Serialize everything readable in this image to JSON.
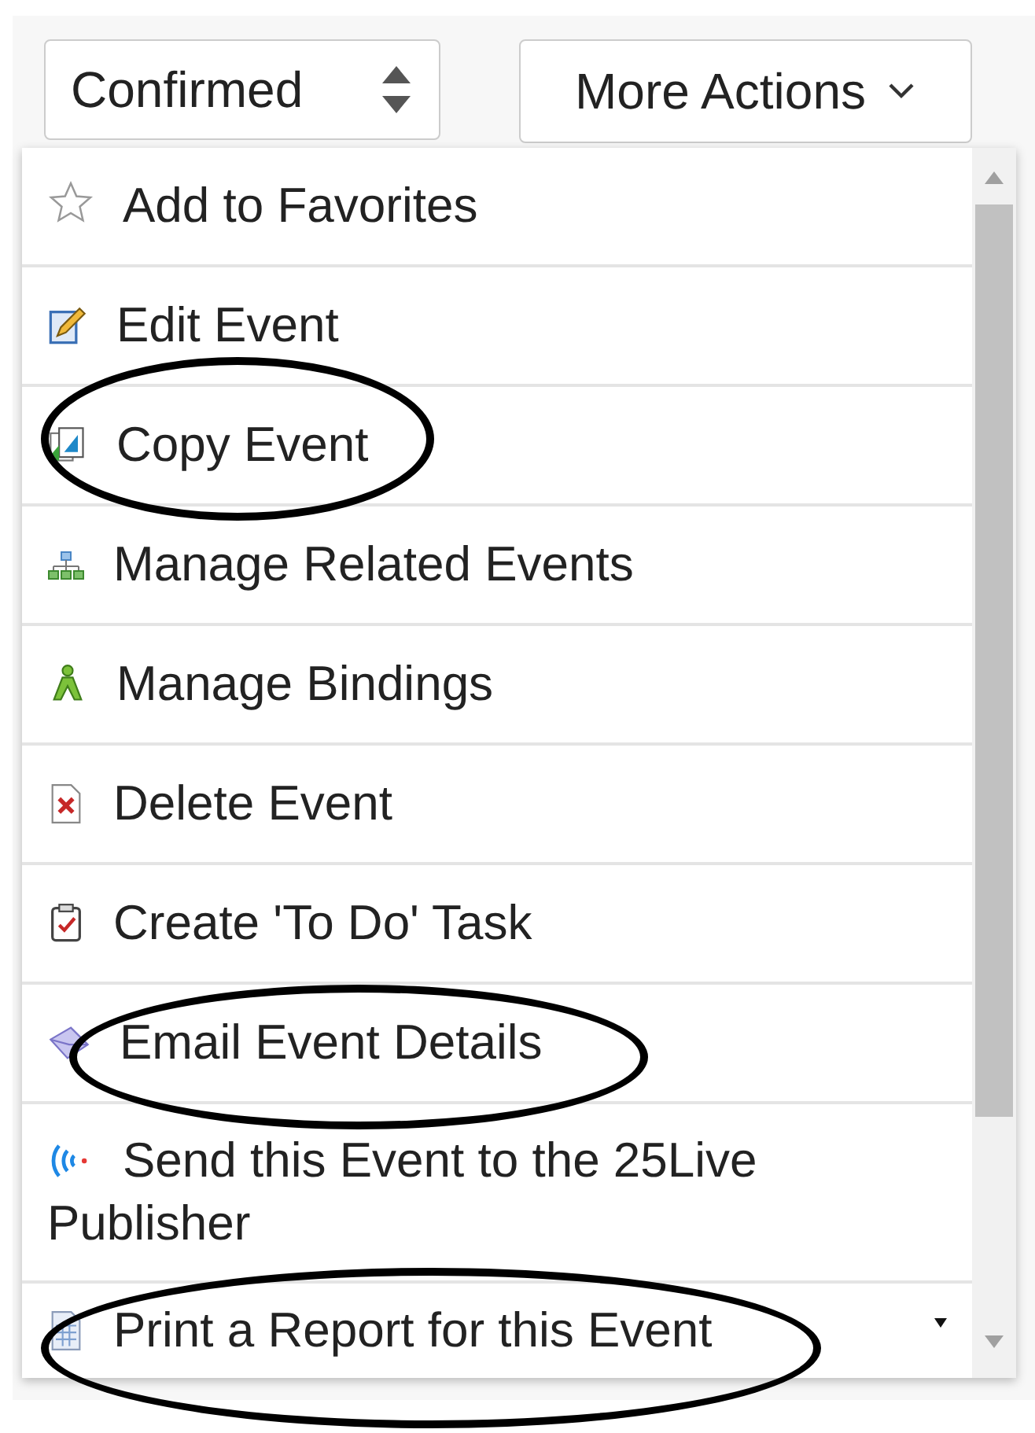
{
  "status_select": {
    "value": "Confirmed"
  },
  "actions_button": {
    "label": "More Actions"
  },
  "menu": {
    "items": [
      {
        "kind": "star",
        "label": "Add to Favorites",
        "circled": false,
        "submenu": false
      },
      {
        "kind": "edit",
        "label": "Edit Event",
        "circled": false,
        "submenu": false
      },
      {
        "kind": "copy",
        "label": "Copy Event",
        "circled": true,
        "submenu": false
      },
      {
        "kind": "related",
        "label": "Manage Related Events",
        "circled": false,
        "submenu": false
      },
      {
        "kind": "bindings",
        "label": "Manage Bindings",
        "circled": false,
        "submenu": false
      },
      {
        "kind": "delete",
        "label": "Delete Event",
        "circled": false,
        "submenu": false
      },
      {
        "kind": "todo",
        "label": "Create 'To Do' Task",
        "circled": false,
        "submenu": false
      },
      {
        "kind": "email",
        "label": "Email Event Details",
        "circled": true,
        "submenu": false
      },
      {
        "kind": "publish",
        "label": "Send this Event to the 25Live Publisher",
        "circled": false,
        "submenu": false
      },
      {
        "kind": "report",
        "label": "Print a Report for this Event",
        "circled": true,
        "submenu": true
      }
    ]
  }
}
